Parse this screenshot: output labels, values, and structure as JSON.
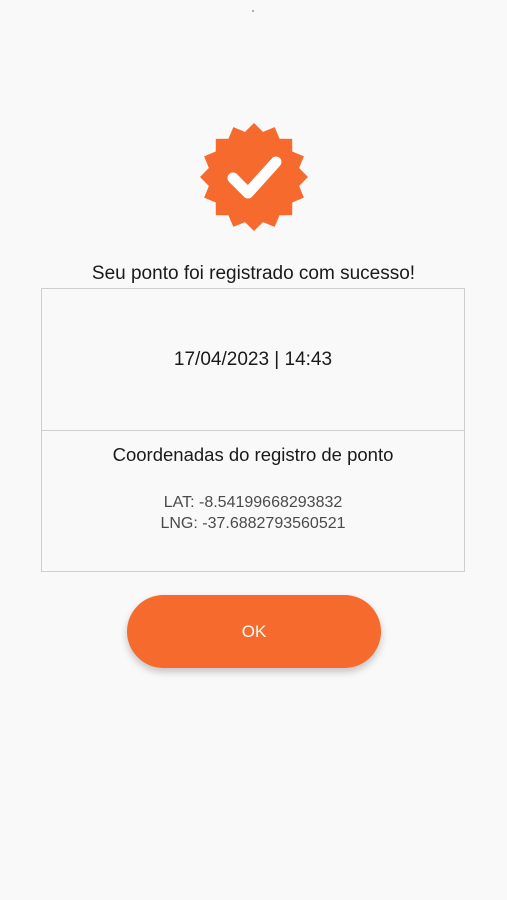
{
  "colors": {
    "accent": "#f66a2d",
    "background": "#f9f9f9",
    "border": "#cfcfcf"
  },
  "icons": {
    "success_badge": "verified-check-badge-icon"
  },
  "dialog": {
    "title": "Seu ponto foi registrado com sucesso!",
    "datetime": "17/04/2023 | 14:43",
    "coords_heading": "Coordenadas do registro de ponto",
    "lat": "LAT: -8.54199668293832",
    "lng": "LNG: -37.6882793560521",
    "ok_label": "OK"
  }
}
